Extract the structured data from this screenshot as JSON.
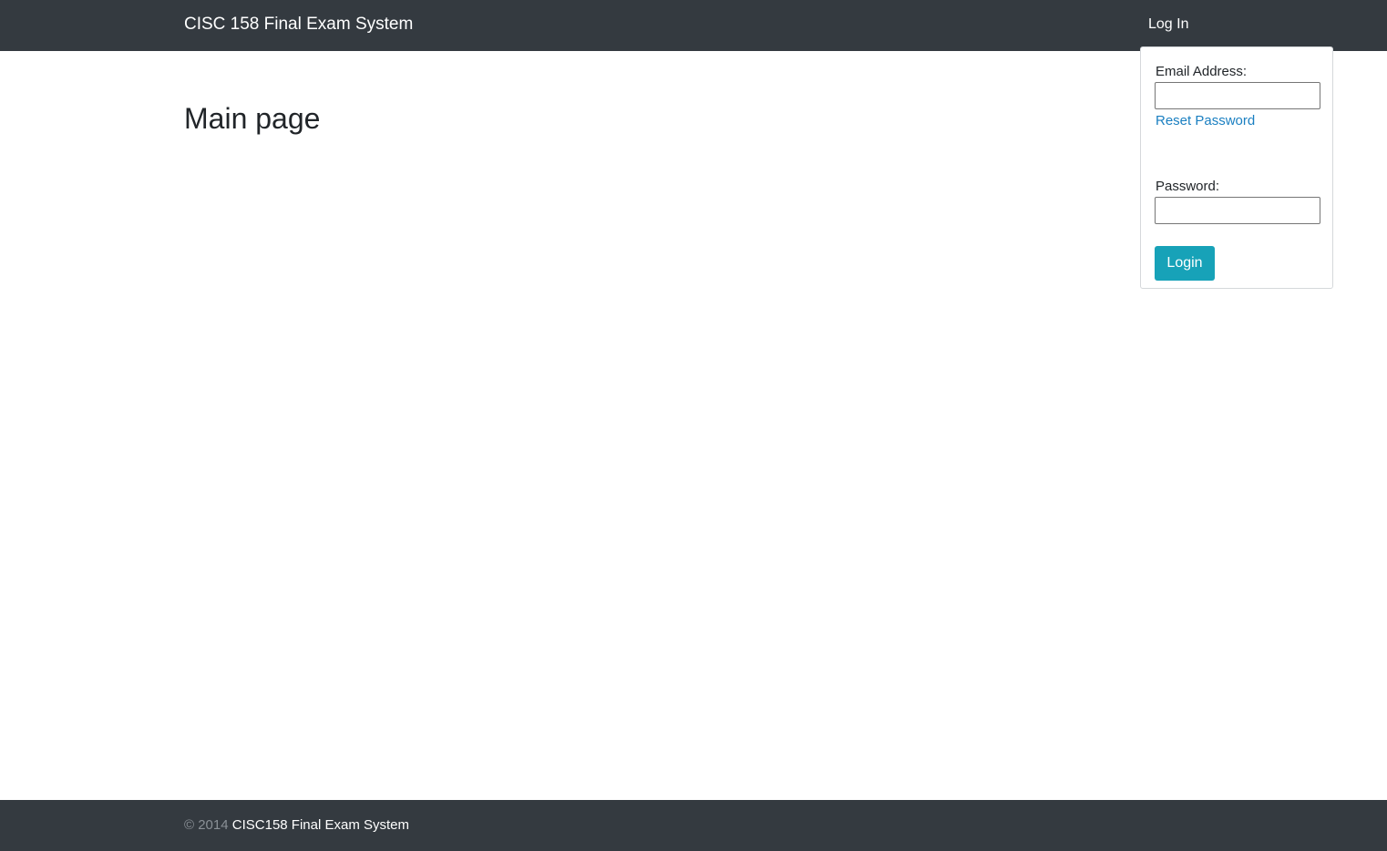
{
  "navbar": {
    "brand": "CISC 158 Final Exam System",
    "login_toggle": "Log In"
  },
  "main": {
    "title": "Main page"
  },
  "login_form": {
    "email_label": "Email Address:",
    "email_value": "",
    "reset_password_link": "Reset Password",
    "password_label": "Password:",
    "password_value": "",
    "submit_label": "Login"
  },
  "footer": {
    "copyright": "© 2014",
    "app_name": "CISC158 Final Exam System"
  },
  "colors": {
    "navbar_bg": "#343a40",
    "button_accent": "#17a2b8",
    "link": "#1a7fc1"
  }
}
